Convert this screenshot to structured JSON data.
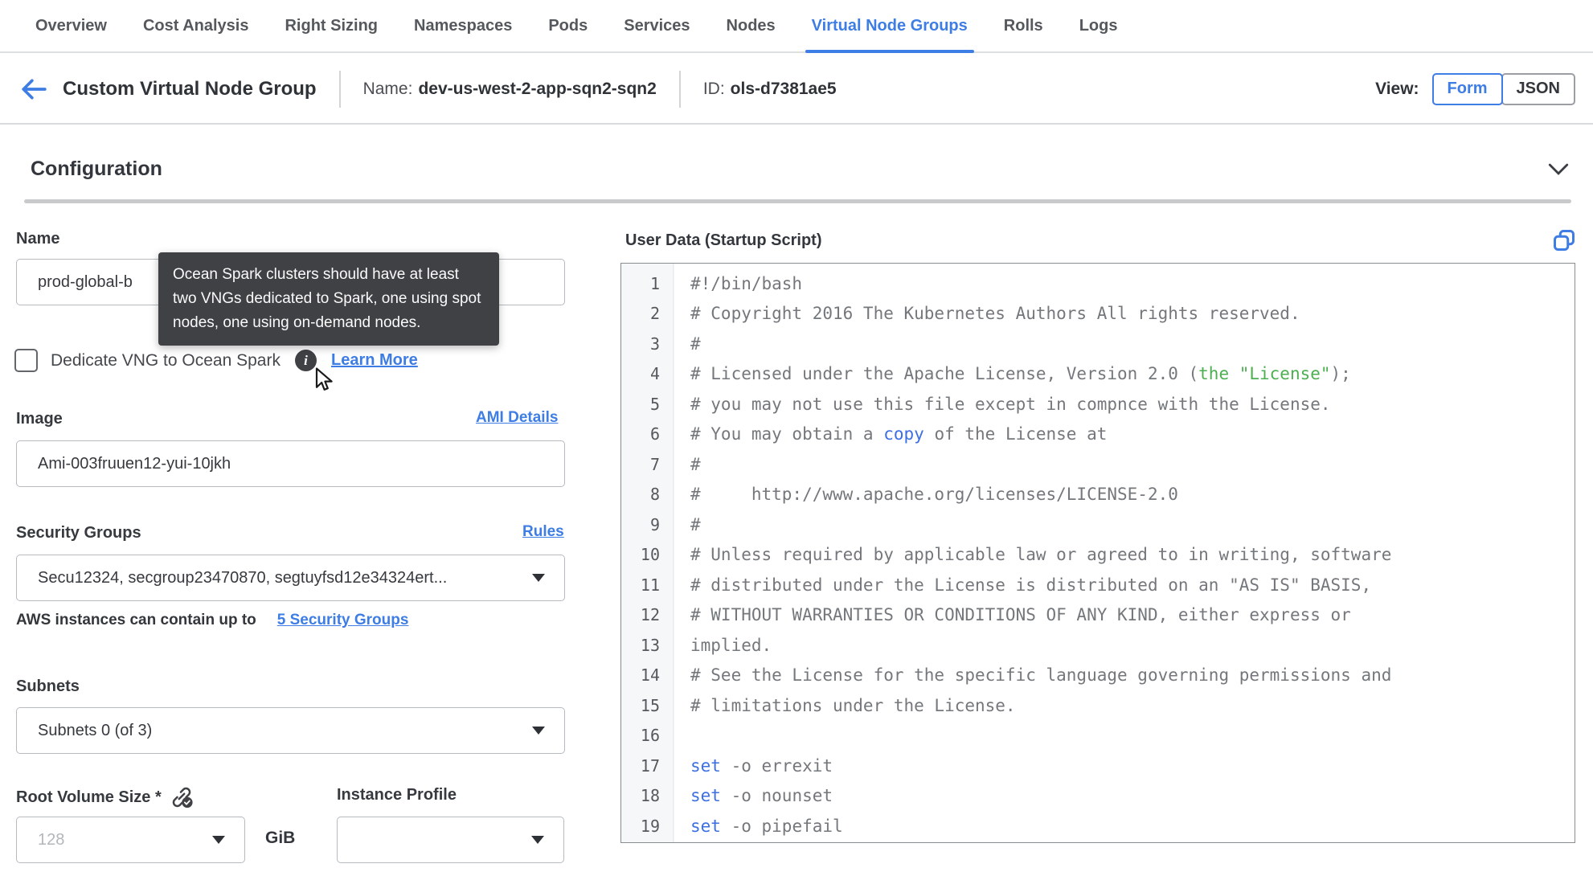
{
  "colors": {
    "accent": "#3D7DE4",
    "tooltip_bg": "#3F4145",
    "code_gray": "#74777B",
    "code_green": "#4CAF50",
    "code_blue": "#3C6FE4",
    "text_dark": "#33373D",
    "border_gray": "#B6BABE"
  },
  "tabs": {
    "items": [
      {
        "label": "Overview",
        "active": false
      },
      {
        "label": "Cost Analysis",
        "active": false
      },
      {
        "label": "Right Sizing",
        "active": false
      },
      {
        "label": "Namespaces",
        "active": false
      },
      {
        "label": "Pods",
        "active": false
      },
      {
        "label": "Services",
        "active": false
      },
      {
        "label": "Nodes",
        "active": false
      },
      {
        "label": "Virtual Node Groups",
        "active": true
      },
      {
        "label": "Rolls",
        "active": false
      },
      {
        "label": "Logs",
        "active": false
      }
    ]
  },
  "header": {
    "title": "Custom Virtual Node Group",
    "name_label": "Name:",
    "name_value": "dev-us-west-2-app-sqn2-sqn2",
    "id_label": "ID:",
    "id_value": "ols-d7381ae5",
    "view_label": "View:",
    "view_options": {
      "form": "Form",
      "json": "JSON"
    },
    "active_view": "Form"
  },
  "section": {
    "title": "Configuration"
  },
  "form": {
    "name": {
      "label": "Name",
      "value": "prod-global-b"
    },
    "dedicate_spark": {
      "label": "Dedicate VNG to Ocean Spark",
      "checked": false,
      "learn_more_label": "Learn More",
      "tooltip_text": "Ocean Spark clusters should have at least two VNGs dedicated to Spark, one using spot nodes, one using on-demand nodes."
    },
    "image": {
      "label": "Image",
      "details_link": "AMI Details",
      "value": "Ami-003fruuen12-yui-10jkh"
    },
    "security_groups": {
      "label": "Security Groups",
      "rules_link": "Rules",
      "value": "Secu12324, secgroup23470870, segtuyfsd12e34324ert...",
      "hint_text": "AWS instances can contain up to",
      "hint_link": "5 Security Groups"
    },
    "subnets": {
      "label": "Subnets",
      "value": "Subnets 0 (of 3)"
    },
    "root_volume_size": {
      "label": "Root Volume Size *",
      "placeholder": "128",
      "unit": "GiB"
    },
    "instance_profile": {
      "label": "Instance Profile",
      "value": ""
    }
  },
  "editor": {
    "title": "User Data (Startup Script)",
    "lines": [
      {
        "num": "1",
        "parts": [
          {
            "t": "#!/bin/bash",
            "c": "g"
          }
        ]
      },
      {
        "num": "2",
        "parts": [
          {
            "t": "# Copyright 2016 The Kubernetes Authors All rights reserved.",
            "c": "g"
          }
        ]
      },
      {
        "num": "3",
        "parts": [
          {
            "t": "#",
            "c": "g"
          }
        ]
      },
      {
        "num": "4",
        "parts": [
          {
            "t": "# Licensed under the Apache License, Version 2.0 (",
            "c": "g"
          },
          {
            "t": "the \"License\"",
            "c": "green"
          },
          {
            "t": ");",
            "c": "g"
          }
        ]
      },
      {
        "num": "5",
        "parts": [
          {
            "t": "# you may not use this file except in compnce with the License.",
            "c": "g"
          }
        ]
      },
      {
        "num": "6",
        "parts": [
          {
            "t": "# You may obtain a ",
            "c": "g"
          },
          {
            "t": "copy",
            "c": "blue"
          },
          {
            "t": " of the License at",
            "c": "g"
          }
        ]
      },
      {
        "num": "7",
        "parts": [
          {
            "t": "#",
            "c": "g"
          }
        ]
      },
      {
        "num": "8",
        "parts": [
          {
            "t": "#     http://www.apache.org/licenses/LICENSE-2.0",
            "c": "g"
          }
        ]
      },
      {
        "num": "9",
        "parts": [
          {
            "t": "#",
            "c": "g"
          }
        ]
      },
      {
        "num": "10",
        "parts": [
          {
            "t": "# Unless required by applicable law or agreed to in writing, software",
            "c": "g"
          }
        ]
      },
      {
        "num": "11",
        "parts": [
          {
            "t": "# distributed under the License is distributed on an \"AS IS\" BASIS,",
            "c": "g"
          }
        ]
      },
      {
        "num": "12",
        "parts": [
          {
            "t": "# WITHOUT WARRANTIES OR CONDITIONS OF ANY KIND, either express or",
            "c": "g"
          }
        ]
      },
      {
        "num": "13",
        "parts": [
          {
            "t": "implied.",
            "c": "g"
          }
        ]
      },
      {
        "num": "14",
        "parts": [
          {
            "t": "# See the License for the specific language governing permissions and",
            "c": "g"
          }
        ]
      },
      {
        "num": "15",
        "parts": [
          {
            "t": "# limitations under the License.",
            "c": "g"
          }
        ]
      },
      {
        "num": "16",
        "parts": []
      },
      {
        "num": "17",
        "parts": [
          {
            "t": "set",
            "c": "blue"
          },
          {
            "t": " -o errexit",
            "c": "g"
          }
        ]
      },
      {
        "num": "18",
        "parts": [
          {
            "t": "set",
            "c": "blue"
          },
          {
            "t": " -o nounset",
            "c": "g"
          }
        ]
      },
      {
        "num": "19",
        "parts": [
          {
            "t": "set",
            "c": "blue"
          },
          {
            "t": " -o pipefail",
            "c": "g"
          }
        ]
      }
    ]
  }
}
